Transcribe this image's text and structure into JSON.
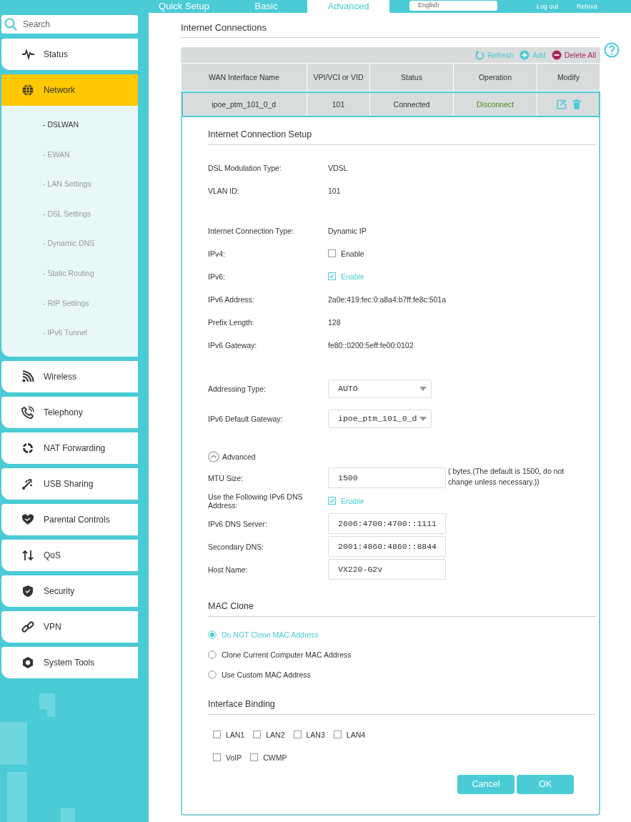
{
  "top_nav": {
    "tabs": [
      {
        "label": "Quick Setup",
        "selected": false
      },
      {
        "label": "Basic",
        "selected": false
      },
      {
        "label": "Advanced",
        "selected": true
      }
    ],
    "language": "English",
    "links": [
      "Log out",
      "Reboot"
    ]
  },
  "sidebar": {
    "search": {
      "placeholder": "Search"
    },
    "items": [
      {
        "label": "Status",
        "selected": false
      },
      {
        "label": "Network",
        "selected": true,
        "expanded": true,
        "children": [
          {
            "label": "- DSLWAN",
            "selected": true
          },
          {
            "label": "- EWAN",
            "selected": false
          },
          {
            "label": "- LAN Settings",
            "selected": false
          },
          {
            "label": "- DSL Settings",
            "selected": false
          },
          {
            "label": "- Dynamic DNS",
            "selected": false
          },
          {
            "label": "- Static Routing",
            "selected": false
          },
          {
            "label": "- RIP Settings",
            "selected": false
          },
          {
            "label": "- IPv6 Tunnel",
            "selected": false
          }
        ]
      },
      {
        "label": "Wireless",
        "selected": false
      },
      {
        "label": "Telephony",
        "selected": false
      },
      {
        "label": "NAT Forwarding",
        "selected": false
      },
      {
        "label": "USB Sharing",
        "selected": false
      },
      {
        "label": "Parental Controls",
        "selected": false
      },
      {
        "label": "QoS",
        "selected": false
      },
      {
        "label": "Security",
        "selected": false
      },
      {
        "label": "VPN",
        "selected": false
      },
      {
        "label": "System Tools",
        "selected": false
      }
    ]
  },
  "main": {
    "title": "Internet Connections",
    "toolbar": [
      {
        "label": "Refresh",
        "kind": "refresh"
      },
      {
        "label": "Add",
        "kind": "add"
      },
      {
        "label": "Delete All",
        "kind": "delete"
      }
    ],
    "table": {
      "columns": [
        "WAN Interface Name",
        "VPI/VCI or VID",
        "Status",
        "Operation",
        "Modify"
      ],
      "rows": [
        {
          "name": "ipoe_ptm_101_0_d",
          "vid": "101",
          "status": "Connected",
          "operation": "Disconnect",
          "selected": true
        }
      ]
    },
    "setup": {
      "title": "Internet Connection Setup",
      "groups": [
        [
          {
            "kind": "text",
            "label": "DSL Modulation Type:",
            "value": "VDSL"
          },
          {
            "kind": "text",
            "label": "VLAN ID:",
            "value": "101"
          }
        ],
        [
          {
            "kind": "text",
            "label": "Internet Connection Type:",
            "value": "Dynamic IP"
          },
          {
            "kind": "checkbox",
            "label": "IPv4:",
            "value": "Enable",
            "checked": false
          },
          {
            "kind": "checkbox",
            "label": "IPv6:",
            "value": "Enable",
            "checked": true
          },
          {
            "kind": "text",
            "label": "IPv6 Address:",
            "value": "2a0e:419:fec:0:a8a4:b7ff:fe8c:501a"
          },
          {
            "kind": "text",
            "label": "Prefix Length:",
            "value": "128"
          },
          {
            "kind": "text",
            "label": "IPv6 Gateway:",
            "value": "fe80::0200:5eff:fe00:0102"
          }
        ],
        [
          {
            "kind": "select",
            "label": "Addressing Type:",
            "value": "AUTO"
          },
          {
            "kind": "select",
            "label": "IPv6 Default Gateway:",
            "value": "ipoe_ptm_101_0_d"
          }
        ]
      ],
      "advanced": {
        "label": "Advanced",
        "expanded": true,
        "rows": [
          {
            "kind": "input",
            "label": "MTU Size:",
            "value": "1500",
            "note": "( bytes.(The default is 1500, do not change unless necessary.))"
          },
          {
            "kind": "checkbox",
            "label": "Use the Following IPv6 DNS Address:",
            "value": "Enable",
            "checked": true
          },
          {
            "kind": "input",
            "label": "IPv6 DNS Server:",
            "value": "2606:4700:4700::1111"
          },
          {
            "kind": "input",
            "label": "Secondary DNS:",
            "value": "2001:4860:4860::8844"
          },
          {
            "kind": "input",
            "label": "Host Name:",
            "value": "VX220-G2v"
          }
        ]
      }
    },
    "mac_clone": {
      "title": "MAC Clone",
      "options": [
        {
          "label": "Do NOT Clone MAC Address",
          "selected": true
        },
        {
          "label": "Clone Current Computer MAC Address",
          "selected": false
        },
        {
          "label": "Use Custom MAC Address",
          "selected": false
        }
      ]
    },
    "interface_binding": {
      "title": "Interface Binding",
      "rows": [
        [
          {
            "label": "LAN1",
            "checked": false
          },
          {
            "label": "LAN2",
            "checked": false
          },
          {
            "label": "LAN3",
            "checked": false
          },
          {
            "label": "LAN4",
            "checked": false
          }
        ],
        [
          {
            "label": "VoIP",
            "checked": false
          },
          {
            "label": "CWMP",
            "checked": false
          }
        ]
      ]
    },
    "buttons": [
      "Cancel",
      "OK"
    ]
  }
}
